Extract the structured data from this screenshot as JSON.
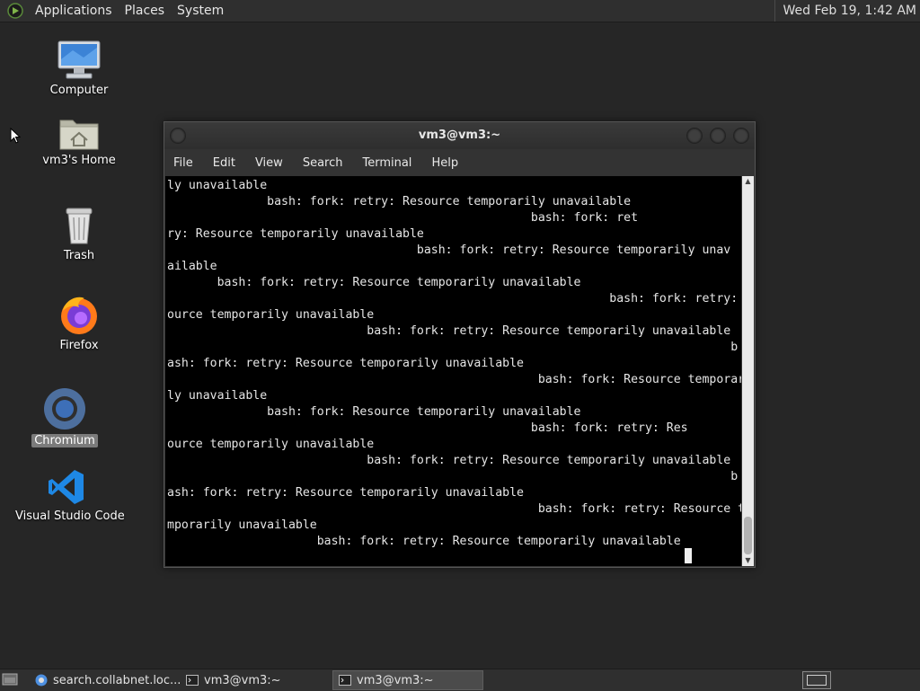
{
  "top_panel": {
    "menus": [
      "Applications",
      "Places",
      "System"
    ],
    "clock": "Wed Feb 19,  1:42 AM"
  },
  "desktop_icons": [
    {
      "label": "Computer",
      "icon": "computer-icon"
    },
    {
      "label": "vm3's Home",
      "icon": "home-folder-icon"
    },
    {
      "label": "Trash",
      "icon": "trash-icon"
    },
    {
      "label": "Firefox",
      "icon": "firefox-icon"
    },
    {
      "label": "Chromium",
      "icon": "chromium-icon",
      "selected": true
    },
    {
      "label": "Visual Studio Code",
      "icon": "vscode-icon"
    }
  ],
  "terminal": {
    "title": "vm3@vm3:~",
    "menu": [
      "File",
      "Edit",
      "View",
      "Search",
      "Terminal",
      "Help"
    ],
    "lines": [
      "ly unavailable",
      "              bash: fork: retry: Resource temporarily unavailable",
      "                                                   bash: fork: ret",
      "ry: Resource temporarily unavailable",
      "                                   bash: fork: retry: Resource temporarily unav",
      "ailable",
      "       bash: fork: retry: Resource temporarily unavailable",
      "                                                              bash: fork: retry: Res",
      "ource temporarily unavailable",
      "                            bash: fork: retry: Resource temporarily unavailable",
      "                                                                               b",
      "ash: fork: retry: Resource temporarily unavailable",
      "                                                    bash: fork: Resource temporari",
      "ly unavailable",
      "              bash: fork: Resource temporarily unavailable",
      "                                                   bash: fork: retry: Res",
      "ource temporarily unavailable",
      "                            bash: fork: retry: Resource temporarily unavailable",
      "                                                                               b",
      "ash: fork: retry: Resource temporarily unavailable",
      "                                                    bash: fork: retry: Resource te",
      "mporarily unavailable",
      "                     bash: fork: retry: Resource temporarily unavailable"
    ]
  },
  "taskbar": {
    "tasks": [
      {
        "label": "search.collabnet.loc...",
        "icon": "chromium-icon"
      },
      {
        "label": "vm3@vm3:~",
        "icon": "terminal-icon"
      },
      {
        "label": "vm3@vm3:~",
        "icon": "terminal-icon",
        "active": true
      }
    ]
  }
}
